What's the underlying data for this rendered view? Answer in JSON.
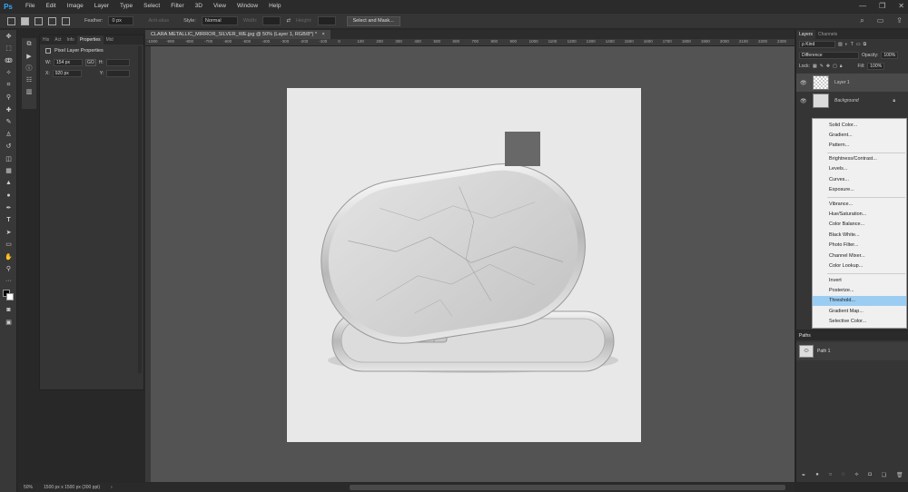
{
  "menubar": {
    "logo": "Ps",
    "items": [
      "File",
      "Edit",
      "Image",
      "Layer",
      "Type",
      "Select",
      "Filter",
      "3D",
      "View",
      "Window",
      "Help"
    ],
    "minimize": "—",
    "restore": "❐",
    "close": "✕"
  },
  "options": {
    "feather_label": "Feather:",
    "feather_value": "0 px",
    "antialias_label": "Anti-alias",
    "style_label": "Style:",
    "style_value": "Normal",
    "width_label": "Width:",
    "height_label": "Height:",
    "select_mask": "Select and Mask..."
  },
  "document": {
    "tab_title": "CLARA METALLIC_MIRROR_SILVER_WE.jpg @ 50% (Layer 1, RGB/8*) *",
    "tab_close": "×",
    "zoom": "50%",
    "size_info": "1500 px x 1500 px (300 ppi)",
    "ruler_ticks": [
      "-1000",
      "-900",
      "-800",
      "-700",
      "-600",
      "-500",
      "-400",
      "-300",
      "-200",
      "-100",
      "0",
      "100",
      "200",
      "300",
      "400",
      "500",
      "600",
      "700",
      "800",
      "900",
      "1000",
      "1100",
      "1200",
      "1300",
      "1400",
      "1500",
      "1600",
      "1700",
      "1800",
      "1900",
      "2000",
      "2100",
      "2200",
      "2300"
    ]
  },
  "properties": {
    "tabs": [
      "His",
      "Act",
      "Info",
      "Properties",
      "Mid"
    ],
    "header": "Pixel Layer Properties",
    "w_label": "W:",
    "w_value": "154 px",
    "link": "GO",
    "h_label": "H:",
    "x_label": "X:",
    "x_value": "920 px",
    "y_label": "Y:"
  },
  "layers": {
    "tabs": [
      "Layers",
      "Channels"
    ],
    "kind": "ρ Kind",
    "blend_mode": "Difference",
    "opacity_label": "Opacity:",
    "opacity_value": "100%",
    "lock_label": "Lock:",
    "fill_label": "Fill:",
    "fill_value": "100%",
    "items": [
      {
        "name": "Layer 1"
      },
      {
        "name": "Background"
      }
    ]
  },
  "adjustment_menu": {
    "items": [
      "Solid Color...",
      "Gradient...",
      "Pattern...",
      "Brightness/Contrast...",
      "Levels...",
      "Curves...",
      "Exposure...",
      "Vibrance...",
      "Hue/Saturation...",
      "Color Balance...",
      "Black  White...",
      "Photo Filter...",
      "Channel Mixer...",
      "Color Lookup...",
      "Invert",
      "Posterize...",
      "Threshold...",
      "Gradient Map...",
      "Selective Color..."
    ],
    "highlighted": "Threshold..."
  },
  "paths": {
    "tab": "Paths",
    "items": [
      {
        "name": "Path 1"
      }
    ]
  },
  "colors": {
    "accent": "#31a8ff",
    "highlight": "#9bcdf2"
  }
}
